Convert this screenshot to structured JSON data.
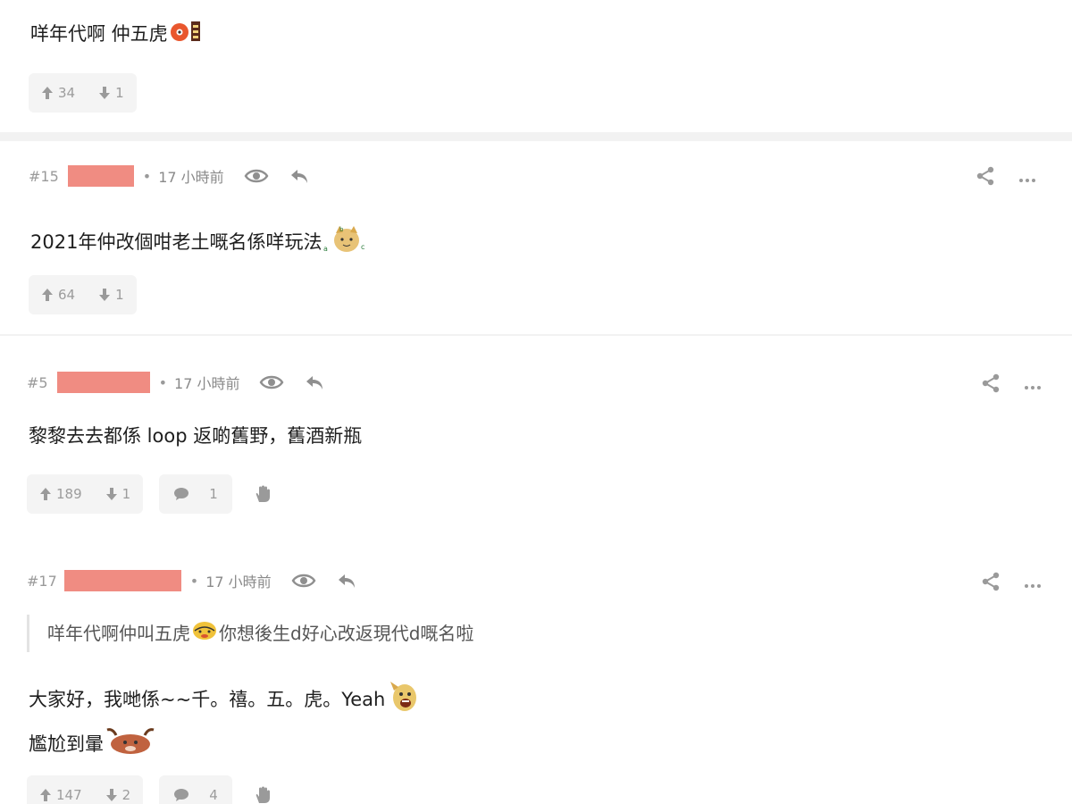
{
  "posts": [
    {
      "text": "咩年代啊 仲五虎",
      "upvotes": "34",
      "downvotes": "1"
    },
    {
      "floor": "#15",
      "time": "17 小時前",
      "text": "2021年仲改個咁老土嘅名係咩玩法",
      "upvotes": "64",
      "downvotes": "1"
    },
    {
      "floor": "#5",
      "time": "17 小時前",
      "text": "黎黎去去都係 loop 返啲舊野，舊酒新瓶",
      "upvotes": "189",
      "downvotes": "1",
      "comments": "1"
    },
    {
      "floor": "#17",
      "time": "17 小時前",
      "quote": "咩年代啊仲叫五虎",
      "quote_tail": "你想後生d好心改返現代d嘅名啦",
      "line1": "大家好，我哋係~~千。禧。五。虎。Yeah",
      "line2": "尷尬到暈",
      "upvotes": "147",
      "downvotes": "2",
      "comments": "4"
    }
  ],
  "colors": {
    "redacted": "#f08c82",
    "icon": "#9a9a9a",
    "pill_bg": "#f4f4f4"
  }
}
